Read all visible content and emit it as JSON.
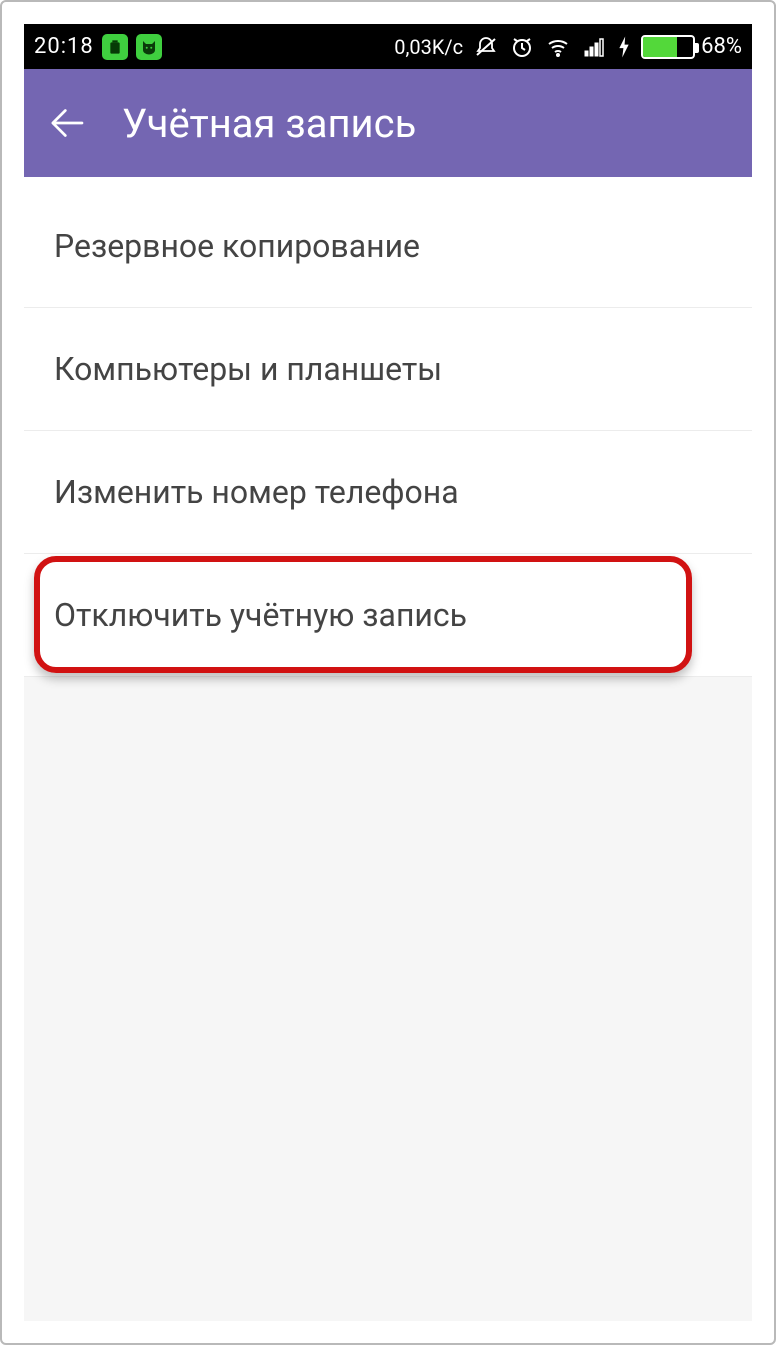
{
  "statusbar": {
    "time": "20:18",
    "data_speed": "0,03K/c",
    "battery_percent": "68%",
    "battery_fill_percent": 68
  },
  "appbar": {
    "title": "Учётная запись"
  },
  "menu": {
    "items": [
      {
        "label": "Резервное копирование",
        "name": "menu-item-backup"
      },
      {
        "label": "Компьютеры и планшеты",
        "name": "menu-item-desktops-tablets"
      },
      {
        "label": "Изменить номер телефона",
        "name": "menu-item-change-phone"
      },
      {
        "label": "Отключить учётную запись",
        "name": "menu-item-deactivate-account",
        "highlighted": true
      }
    ]
  }
}
